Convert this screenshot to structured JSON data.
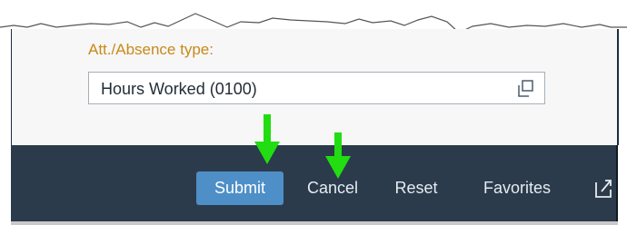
{
  "form": {
    "field_label": "Att./Absence type:",
    "field_value": "Hours Worked (0100)",
    "value_help_icon": "value-help-icon"
  },
  "toolbar": {
    "submit_label": "Submit",
    "cancel_label": "Cancel",
    "reset_label": "Reset",
    "favorites_label": "Favorites",
    "share_icon": "share-icon"
  },
  "annotations": {
    "arrow_icon": "down-arrow-icon",
    "arrow_color": "#22dd11"
  },
  "colors": {
    "label": "#c8891a",
    "toolbar_bg": "#2b3b4c",
    "primary_button": "#4e8fc7"
  }
}
